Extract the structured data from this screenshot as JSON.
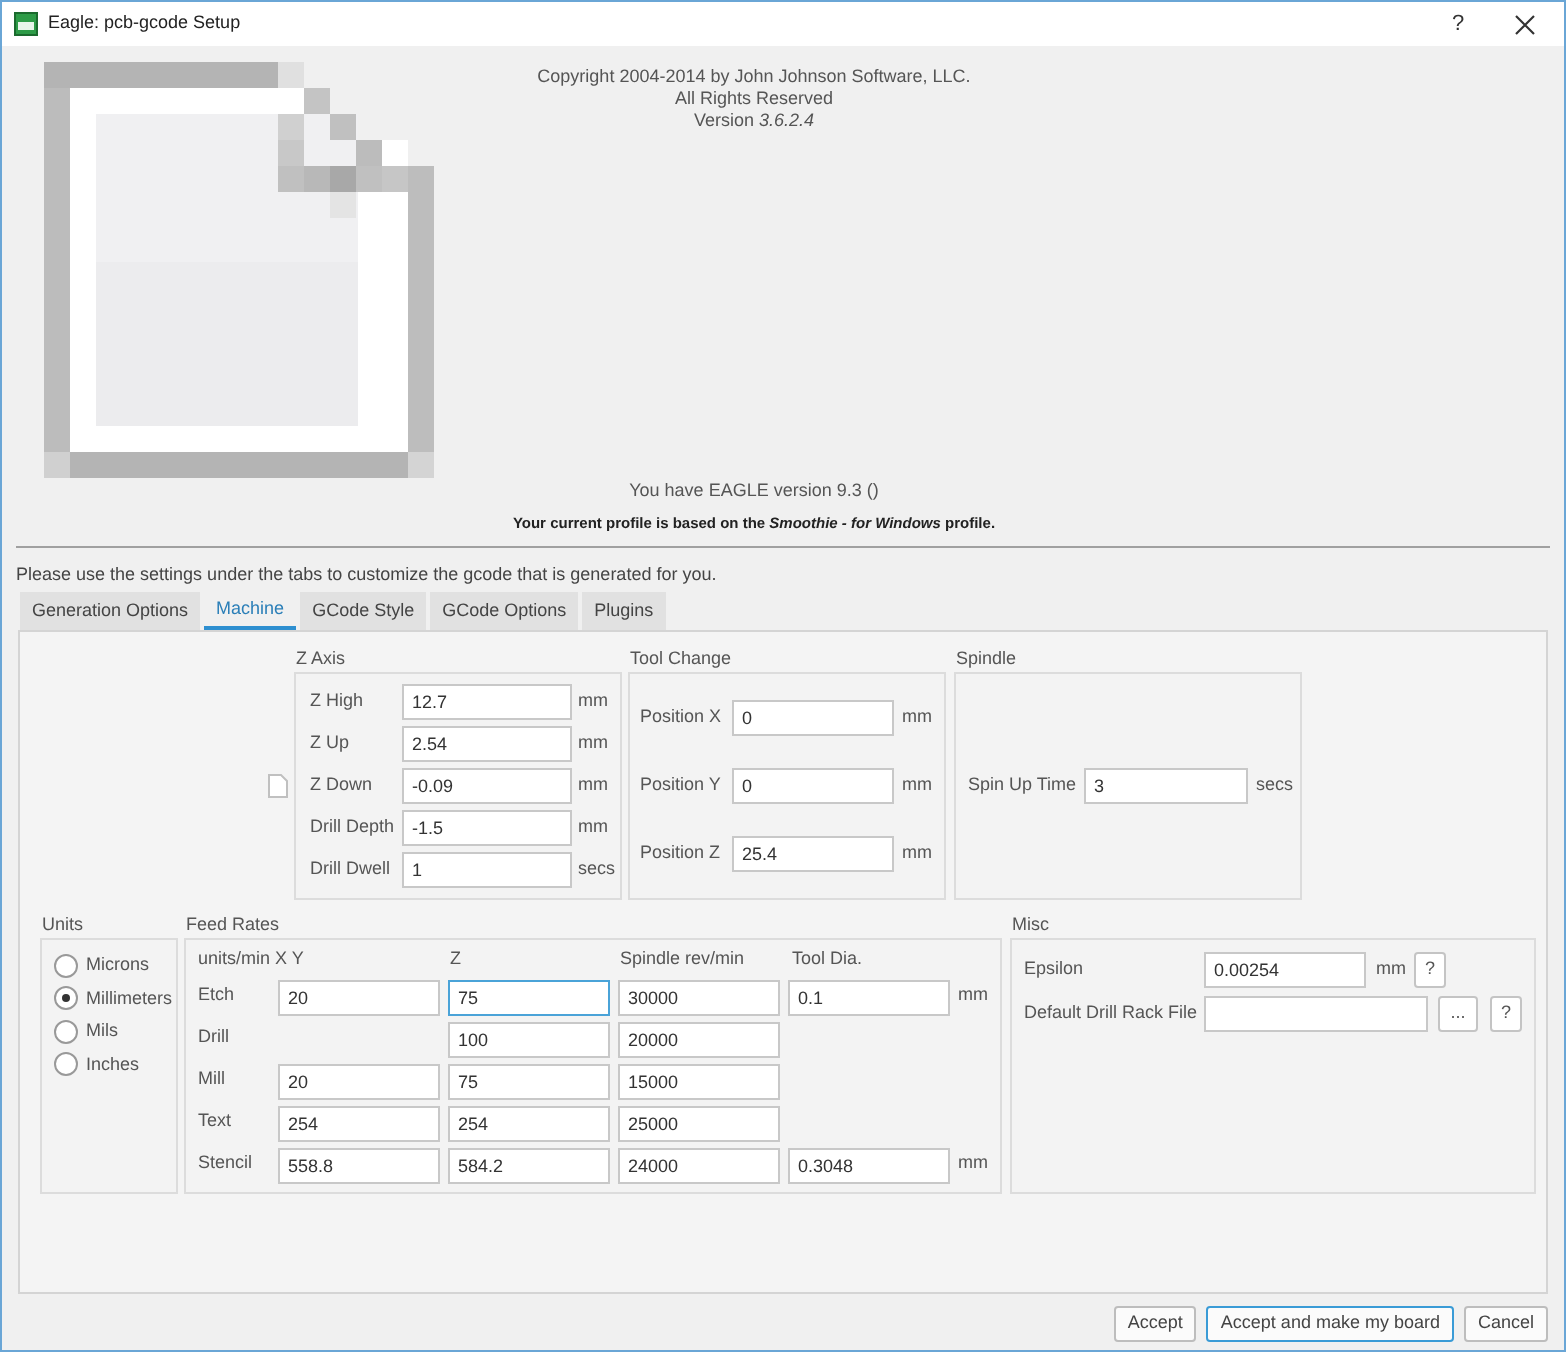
{
  "window": {
    "title": "Eagle: pcb-gcode Setup",
    "help": "?"
  },
  "about": {
    "copyright": "Copyright 2004-2014 by John Johnson Software, LLC.",
    "rights": "All Rights Reserved",
    "version": "Version *3.6.2.4*",
    "eagle_version": "You have EAGLE version 9.3 ()",
    "profile_note": "Your current profile is based on the *Smoothie - for Windows* profile."
  },
  "instructions": "Please use the settings under the tabs to customize the gcode that is generated for you.",
  "tabs": [
    {
      "label": "Generation Options",
      "selected": false
    },
    {
      "label": "Machine",
      "selected": true
    },
    {
      "label": "GCode Style",
      "selected": false
    },
    {
      "label": "GCode Options",
      "selected": false
    },
    {
      "label": "Plugins",
      "selected": false
    }
  ],
  "z_axis": {
    "title": "Z Axis",
    "rows": [
      {
        "label": "Z High",
        "value": "12.7",
        "unit": "mm"
      },
      {
        "label": "Z Up",
        "value": "2.54",
        "unit": "mm"
      },
      {
        "label": "Z Down",
        "value": "-0.09",
        "unit": "mm"
      },
      {
        "label": "Drill Depth",
        "value": "-1.5",
        "unit": "mm"
      },
      {
        "label": "Drill Dwell",
        "value": "1",
        "unit": "secs"
      }
    ]
  },
  "tool_change": {
    "title": "Tool Change",
    "rows": [
      {
        "label": "Position X",
        "value": "0",
        "unit": "mm"
      },
      {
        "label": "Position Y",
        "value": "0",
        "unit": "mm"
      },
      {
        "label": "Position Z",
        "value": "25.4",
        "unit": "mm"
      }
    ]
  },
  "spindle": {
    "title": "Spindle",
    "label": "Spin Up Time",
    "value": "3",
    "unit": "secs"
  },
  "units": {
    "title": "Units",
    "options": [
      {
        "label": "Microns",
        "selected": false
      },
      {
        "label": "Millimeters",
        "selected": true
      },
      {
        "label": "Mils",
        "selected": false
      },
      {
        "label": "Inches",
        "selected": false
      }
    ]
  },
  "feed_rates": {
    "title": "Feed Rates",
    "columns": [
      "units/min  X Y",
      "Z",
      "Spindle rev/min",
      "Tool Dia."
    ],
    "rows": [
      {
        "label": "Etch",
        "xy": {
          "value": "20",
          "focused": false
        },
        "z": {
          "value": "75",
          "focused": true
        },
        "spindle": {
          "value": "30000",
          "focused": false
        },
        "tool_dia": {
          "value": "0.1",
          "focused": false
        },
        "unit": "mm"
      },
      {
        "label": "Drill",
        "z": {
          "value": "100",
          "focused": false
        },
        "spindle": {
          "value": "20000",
          "focused": false
        }
      },
      {
        "label": "Mill",
        "xy": {
          "value": "20",
          "focused": false
        },
        "z": {
          "value": "75",
          "focused": false
        },
        "spindle": {
          "value": "15000",
          "focused": false
        }
      },
      {
        "label": "Text",
        "xy": {
          "value": "254",
          "focused": false
        },
        "z": {
          "value": "254",
          "focused": false
        },
        "spindle": {
          "value": "25000",
          "focused": false
        }
      },
      {
        "label": "Stencil",
        "xy": {
          "value": "558.8",
          "focused": false
        },
        "z": {
          "value": "584.2",
          "focused": false
        },
        "spindle": {
          "value": "24000",
          "focused": false
        },
        "tool_dia": {
          "value": "0.3048",
          "focused": false
        },
        "unit": "mm"
      }
    ]
  },
  "misc": {
    "title": "Misc",
    "epsilon": {
      "label": "Epsilon",
      "value": "0.00254",
      "unit": "mm",
      "help": "?"
    },
    "drill_rack": {
      "label": "Default Drill Rack File",
      "browse": "...",
      "help": "?"
    }
  },
  "buttons": [
    {
      "label": "Accept",
      "default": false
    },
    {
      "label": "Accept and make my board",
      "default": true
    },
    {
      "label": "Cancel",
      "default": false
    }
  ]
}
